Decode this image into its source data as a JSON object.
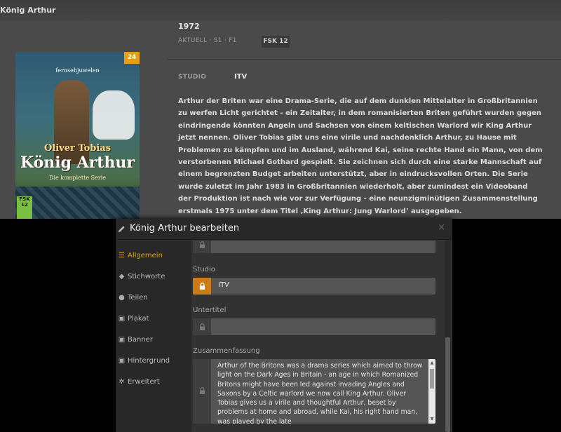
{
  "background": {
    "title": "König Arthur",
    "year": "1972",
    "meta": "AKTUELL  ·  S1  ·  F1",
    "fsk": "FSK 12",
    "studio_label": "STUDIO",
    "studio_value": "ITV",
    "summary": "Arthur der Briten war eine Drama-Serie, die auf dem dunklen Mittelalter in Großbritannien zu werfen Licht gerichtet - ein Zeitalter, in dem romanisierten Briten geführt wurden gegen eindringende könnten Angeln und Sachsen von einem keltischen Warlord wir King Arthur jetzt nennen. Oliver Tobias gibt uns eine virile und nachdenklich Arthur, zu Hause mit Problemen zu kämpfen und im Ausland, während Kai, seine rechte Hand ein Mann, von dem verstorbenen Michael Gothard gespielt. Sie zeichnen sich durch eine starke Mannschaft auf einem begrenzten Budget arbeiten unterstützt, aber in eindrucksvollen Orten. Die Serie wurde zuletzt im Jahr 1983 in Großbritannien wiederholt, aber zumindest ein Videoband der Produktion ist nach wie vor zur Verfügung - eine neunzigminütigen Zusammenstellung erstmals 1975 unter dem Titel ‚King Arthur: Jung Warlord‘ ausgegeben.",
    "poster": {
      "badge": "24",
      "logo": "fernsehjuwelen",
      "actor": "Oliver Tobias",
      "title": "König Arthur",
      "subtitle": "Die komplette Serie",
      "fsk": "FSK 12"
    }
  },
  "modal": {
    "title": "König Arthur bearbeiten",
    "close_label": "×",
    "nav": [
      {
        "label": "Allgemein",
        "icon": "list-icon",
        "active": true
      },
      {
        "label": "Stichworte",
        "icon": "tag-icon"
      },
      {
        "label": "Teilen",
        "icon": "users-icon"
      },
      {
        "label": "Plakat",
        "icon": "image-icon"
      },
      {
        "label": "Banner",
        "icon": "image-icon"
      },
      {
        "label": "Hintergrund",
        "icon": "image-icon"
      },
      {
        "label": "Erweitert",
        "icon": "gear-icon"
      }
    ],
    "fields": {
      "studio_label": "Studio",
      "studio_value": "ITV",
      "subtitle_label": "Untertitel",
      "subtitle_value": "",
      "summary_label": "Zusammenfassung",
      "summary_value": "Arthur of the Britons was a drama series which aimed to throw light on the Dark Ages in Britain - an age in which Romanized Britons might have been led against invading Angles and Saxons by a Celtic warlord we now call King Arthur. Oliver Tobias gives us a virile and thoughtful Arthur, beset by problems at home and abroad, while Kai, his right hand man, was played by the late"
    }
  },
  "colors": {
    "accent": "#e5a00d",
    "lock_active": "#cc7b19"
  }
}
